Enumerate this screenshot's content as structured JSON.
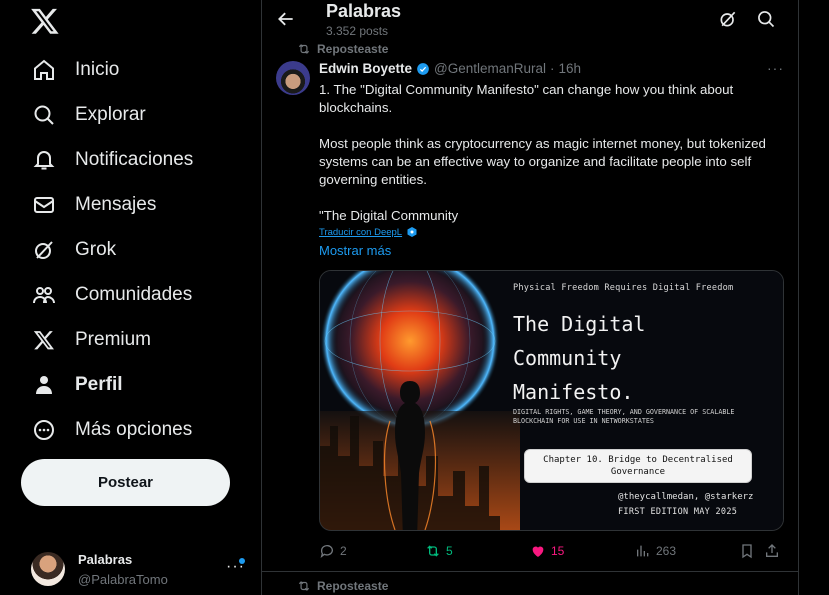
{
  "nav": {
    "items": [
      {
        "label": "Inicio",
        "icon": "home-icon"
      },
      {
        "label": "Explorar",
        "icon": "search-icon"
      },
      {
        "label": "Notificaciones",
        "icon": "bell-icon"
      },
      {
        "label": "Mensajes",
        "icon": "mail-icon"
      },
      {
        "label": "Grok",
        "icon": "grok-icon"
      },
      {
        "label": "Comunidades",
        "icon": "communities-icon"
      },
      {
        "label": "Premium",
        "icon": "x-icon"
      },
      {
        "label": "Perfil",
        "icon": "person-icon"
      },
      {
        "label": "Más opciones",
        "icon": "more-circle-icon"
      }
    ],
    "post_label": "Postear"
  },
  "account": {
    "name": "Palabras",
    "handle": "@PalabraTomo",
    "more": "···"
  },
  "header": {
    "title": "Palabras",
    "subtitle": "3.352 posts"
  },
  "tweet": {
    "reposted_label": "Reposteaste",
    "author_name": "Edwin Boyette",
    "author_handle": "@GentlemanRural",
    "separator": "·",
    "time": "16h",
    "text": [
      "1. The \"Digital Community Manifesto\" can change how you think about blockchains.",
      "Most people think as cryptocurrency as magic internet money, but tokenized systems can be an effective way to organize and facilitate people into self governing entities.",
      "\"The Digital Community"
    ],
    "translate_label": "Traducir con DeepL",
    "show_more": "Mostrar más",
    "media": {
      "top": "Physical Freedom Requires Digital Freedom",
      "title_lines": [
        "The Digital",
        "Community",
        "Manifesto."
      ],
      "subtitle": "DIGITAL RIGHTS, GAME THEORY, AND GOVERNANCE OF SCALABLE BLOCKCHAIN FOR USE IN NETWORKSTATES",
      "chapter": "Chapter 10. Bridge to Decentralised Governance",
      "credit": "@theycallmedan, @starkerz",
      "edition": "FIRST EDITION MAY 2025"
    },
    "stats": {
      "replies": "2",
      "reposts": "5",
      "likes": "15",
      "views": "263"
    },
    "colors": {
      "repost": "#00ba7c",
      "like": "#f91880",
      "accent": "#1d9bf0"
    }
  },
  "next_repost_label": "Reposteaste"
}
